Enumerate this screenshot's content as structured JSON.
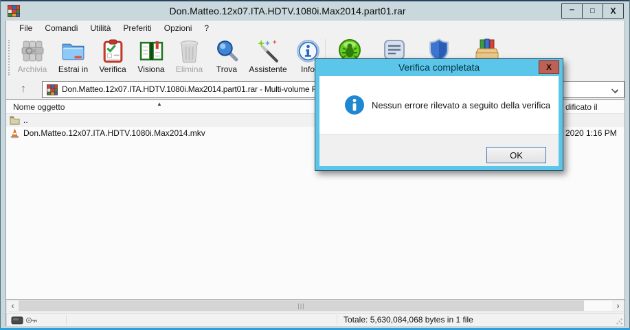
{
  "window": {
    "title": "Don.Matteo.12x07.ITA.HDTV.1080i.Max2014.part01.rar",
    "controls": {
      "minimize": "–",
      "maximize": "□",
      "close": "X"
    }
  },
  "menubar": {
    "items": [
      "File",
      "Comandi",
      "Utilità",
      "Preferiti",
      "Opzioni",
      "?"
    ]
  },
  "toolbar": {
    "buttons": [
      {
        "label": "Archivia",
        "disabled": true
      },
      {
        "label": "Estrai in",
        "disabled": false
      },
      {
        "label": "Verifica",
        "disabled": false
      },
      {
        "label": "Visiona",
        "disabled": false
      },
      {
        "label": "Elimina",
        "disabled": true
      },
      {
        "label": "Trova",
        "disabled": false
      },
      {
        "label": "Assistente",
        "disabled": false
      },
      {
        "label": "Info",
        "disabled": false
      }
    ],
    "right_icons": [
      "virus-scan",
      "comment",
      "protect",
      "sfx-box"
    ]
  },
  "addressbar": {
    "up_icon": "↑",
    "archive_path": "Don.Matteo.12x07.ITA.HDTV.1080i.Max2014.part01.rar - Multi-volume R"
  },
  "file_list": {
    "columns": {
      "name": "Nome oggetto",
      "modified_partial": "dificato il"
    },
    "sort_icon": "▲",
    "rows": [
      {
        "icon": "folder-up",
        "name": "..",
        "modified": ""
      },
      {
        "icon": "video-file",
        "name": "Don.Matteo.12x07.ITA.HDTV.1080i.Max2014.mkv",
        "modified": "2020 1:16 PM"
      }
    ]
  },
  "dialog": {
    "title": "Verifica completata",
    "close_icon": "X",
    "message": "Nessun errore rilevato a seguito della verifica",
    "ok_label": "OK"
  },
  "hscrollbar": {
    "left_arrow": "‹",
    "right_arrow": "›",
    "grip": "|||"
  },
  "statusbar": {
    "total": "Totale: 5,630,084,068 bytes in 1 file"
  },
  "colors": {
    "titlebar": "#c9d8dd",
    "dialog_titlebar": "#5bc6e9",
    "dialog_close_button": "#bf6055",
    "info_icon_blue": "#1e88d2",
    "window_bottom_edge": "#2f9fd8",
    "toolbar_bg": "#f1f1f1",
    "selected_row": "#f1f1f1"
  }
}
